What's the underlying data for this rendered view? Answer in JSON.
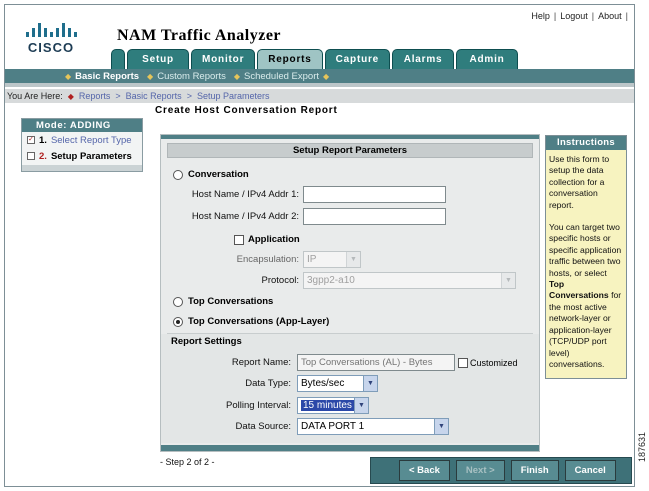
{
  "header": {
    "logo_text": "CISCO",
    "app_title": "NAM Traffic Analyzer",
    "util_links": [
      "Help",
      "Logout",
      "About"
    ]
  },
  "tabs": [
    {
      "label": "Setup",
      "active": false
    },
    {
      "label": "Monitor",
      "active": false
    },
    {
      "label": "Reports",
      "active": true
    },
    {
      "label": "Capture",
      "active": false
    },
    {
      "label": "Alarms",
      "active": false
    },
    {
      "label": "Admin",
      "active": false
    }
  ],
  "subnav": [
    {
      "label": "Basic Reports",
      "active": true
    },
    {
      "label": "Custom Reports",
      "active": false
    },
    {
      "label": "Scheduled Export",
      "active": false
    }
  ],
  "breadcrumb": {
    "prefix": "You Are Here:",
    "items": [
      "Reports",
      "Basic Reports",
      "Setup Parameters"
    ]
  },
  "page_title": "Create Host Conversation Report",
  "mode_panel": {
    "title": "Mode: ADDING",
    "steps": [
      {
        "num": "1.",
        "label": "Select Report Type"
      },
      {
        "num": "2.",
        "label": "Setup Parameters"
      }
    ]
  },
  "form": {
    "section_title": "Setup Report Parameters",
    "conversation_label": "Conversation",
    "host1_label": "Host Name / IPv4 Addr 1:",
    "host1_value": "",
    "host2_label": "Host Name / IPv4 Addr 2:",
    "host2_value": "",
    "application_label": "Application",
    "encapsulation_label": "Encapsulation:",
    "encapsulation_value": "IP",
    "protocol_label": "Protocol:",
    "protocol_value": "3gpp2-a10",
    "top_conversations_label": "Top Conversations",
    "top_conversations_app_label": "Top Conversations (App-Layer)",
    "report_settings_title": "Report Settings",
    "report_name_label": "Report Name:",
    "report_name_placeholder": "Top Conversations (AL) - Bytes",
    "customized_label": "Customized",
    "data_type_label": "Data Type:",
    "data_type_value": "Bytes/sec",
    "polling_label": "Polling Interval:",
    "polling_value": "15 minutes",
    "data_source_label": "Data Source:",
    "data_source_value": "DATA PORT 1"
  },
  "instructions": {
    "title": "Instructions",
    "para1": "Use this form to setup the data collection for a conversation report.",
    "para2_a": "You can target two specific hosts or specific application traffic between two hosts, or select ",
    "para2_bold": "Top Conversations",
    "para2_b": " for the most active network-layer or application-layer (TCP/UDP port level) conversations."
  },
  "footer": {
    "step_text": "- Step 2 of 2 -",
    "buttons": [
      {
        "label": "< Back",
        "enabled": true
      },
      {
        "label": "Next >",
        "enabled": false
      },
      {
        "label": "Finish",
        "enabled": true
      },
      {
        "label": "Cancel",
        "enabled": true
      }
    ],
    "figure_id": "187631"
  },
  "colors": {
    "teal_dark": "#4f7f86",
    "tab_teal": "#2f7d7d",
    "tab_active": "#9fc4c4",
    "instructions_bg": "#f7f3c0"
  }
}
